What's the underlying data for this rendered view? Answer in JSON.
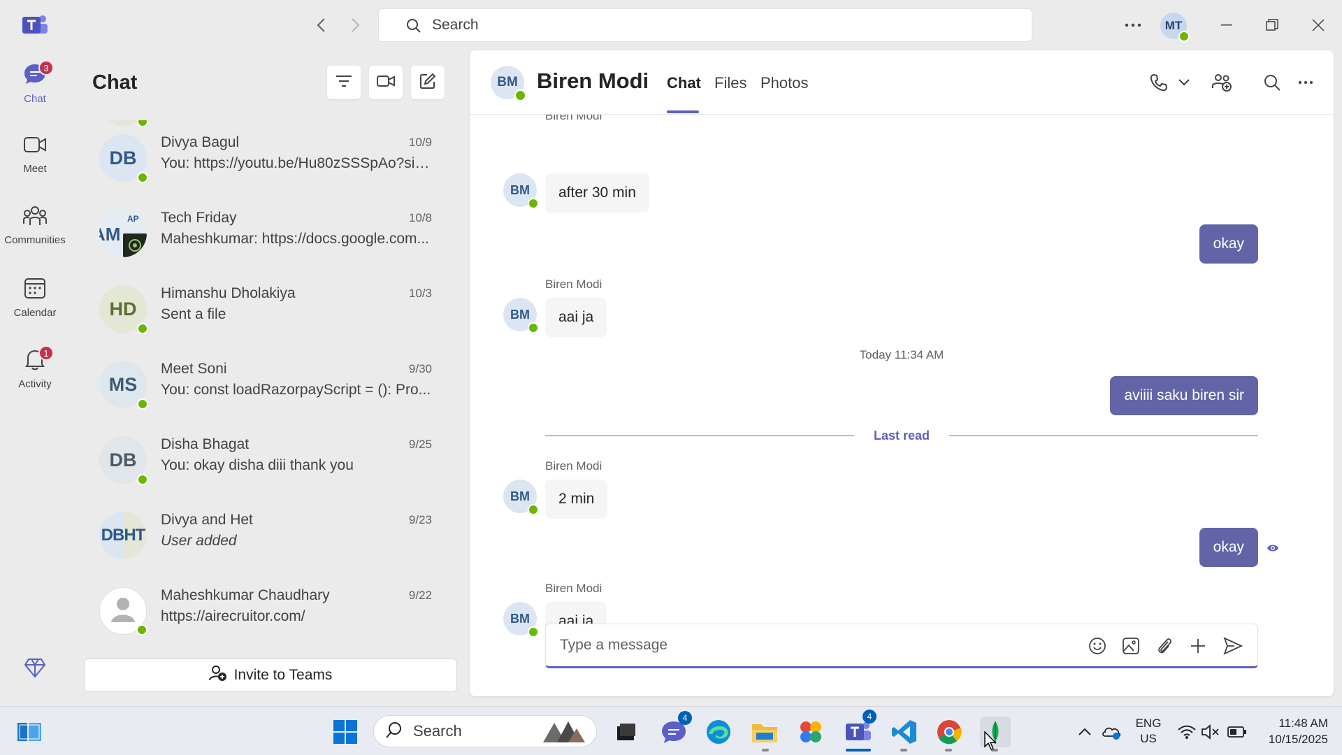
{
  "titlebar": {
    "search_placeholder": "Search",
    "me_initials": "MT"
  },
  "rail": {
    "items": [
      {
        "label": "Chat",
        "icon": "chat-icon",
        "badge": "3",
        "active": true
      },
      {
        "label": "Meet",
        "icon": "video-icon",
        "badge": "",
        "active": false
      },
      {
        "label": "Communities",
        "icon": "communities-icon",
        "badge": "",
        "active": false
      },
      {
        "label": "Calendar",
        "icon": "calendar-icon",
        "badge": "",
        "active": false
      },
      {
        "label": "Activity",
        "icon": "bell-icon",
        "badge": "1",
        "active": false
      }
    ]
  },
  "chat_list": {
    "title": "Chat",
    "invite_label": "Invite to Teams",
    "items": [
      {
        "initials": "DB",
        "name": "Divya Bagul",
        "date": "10/9",
        "preview": "You: https://youtu.be/Hu80zSSSpAo?si=...",
        "italic": false
      },
      {
        "initials": "AM",
        "name": "Tech Friday",
        "date": "10/8",
        "preview": "Maheshkumar: https://docs.google.com...",
        "italic": false
      },
      {
        "initials": "HD",
        "name": "Himanshu Dholakiya",
        "date": "10/3",
        "preview": "Sent a file",
        "italic": false
      },
      {
        "initials": "MS",
        "name": "Meet Soni",
        "date": "9/30",
        "preview": "You: const loadRazorpayScript = (): Pro...",
        "italic": false
      },
      {
        "initials": "DB",
        "name": "Disha Bhagat",
        "date": "9/25",
        "preview": "You: okay disha diii thank you",
        "italic": false
      },
      {
        "initials": "DBHT",
        "name": "Divya and Het",
        "date": "9/23",
        "preview": "User added",
        "italic": true
      },
      {
        "initials": "",
        "name": "Maheshkumar Chaudhary",
        "date": "9/22",
        "preview": "https://airecruitor.com/",
        "italic": false
      }
    ]
  },
  "conversation": {
    "initials": "BM",
    "name": "Biren Modi",
    "tabs": [
      "Chat",
      "Files",
      "Photos"
    ],
    "messages": {
      "m1": "after 30 min",
      "m2": "okay",
      "sender": "Biren Modi",
      "m3": "aai ja",
      "time_separator": "Today 11:34 AM",
      "m4": "aviiii saku biren sir",
      "last_read": "Last read",
      "m5": "2 min",
      "m6": "okay",
      "m7": "aai ja"
    },
    "composer_placeholder": "Type a message"
  },
  "taskbar": {
    "search_label": "Search",
    "teams_badge": "4",
    "chat_badge": "4",
    "lang_top": "ENG",
    "lang_bottom": "US",
    "time": "11:48 AM",
    "date": "10/15/2025"
  },
  "colors": {
    "accent": "#5b5fc7",
    "bubble_out": "#6264a7",
    "presence": "#6bb700",
    "badge": "#c4314b"
  }
}
